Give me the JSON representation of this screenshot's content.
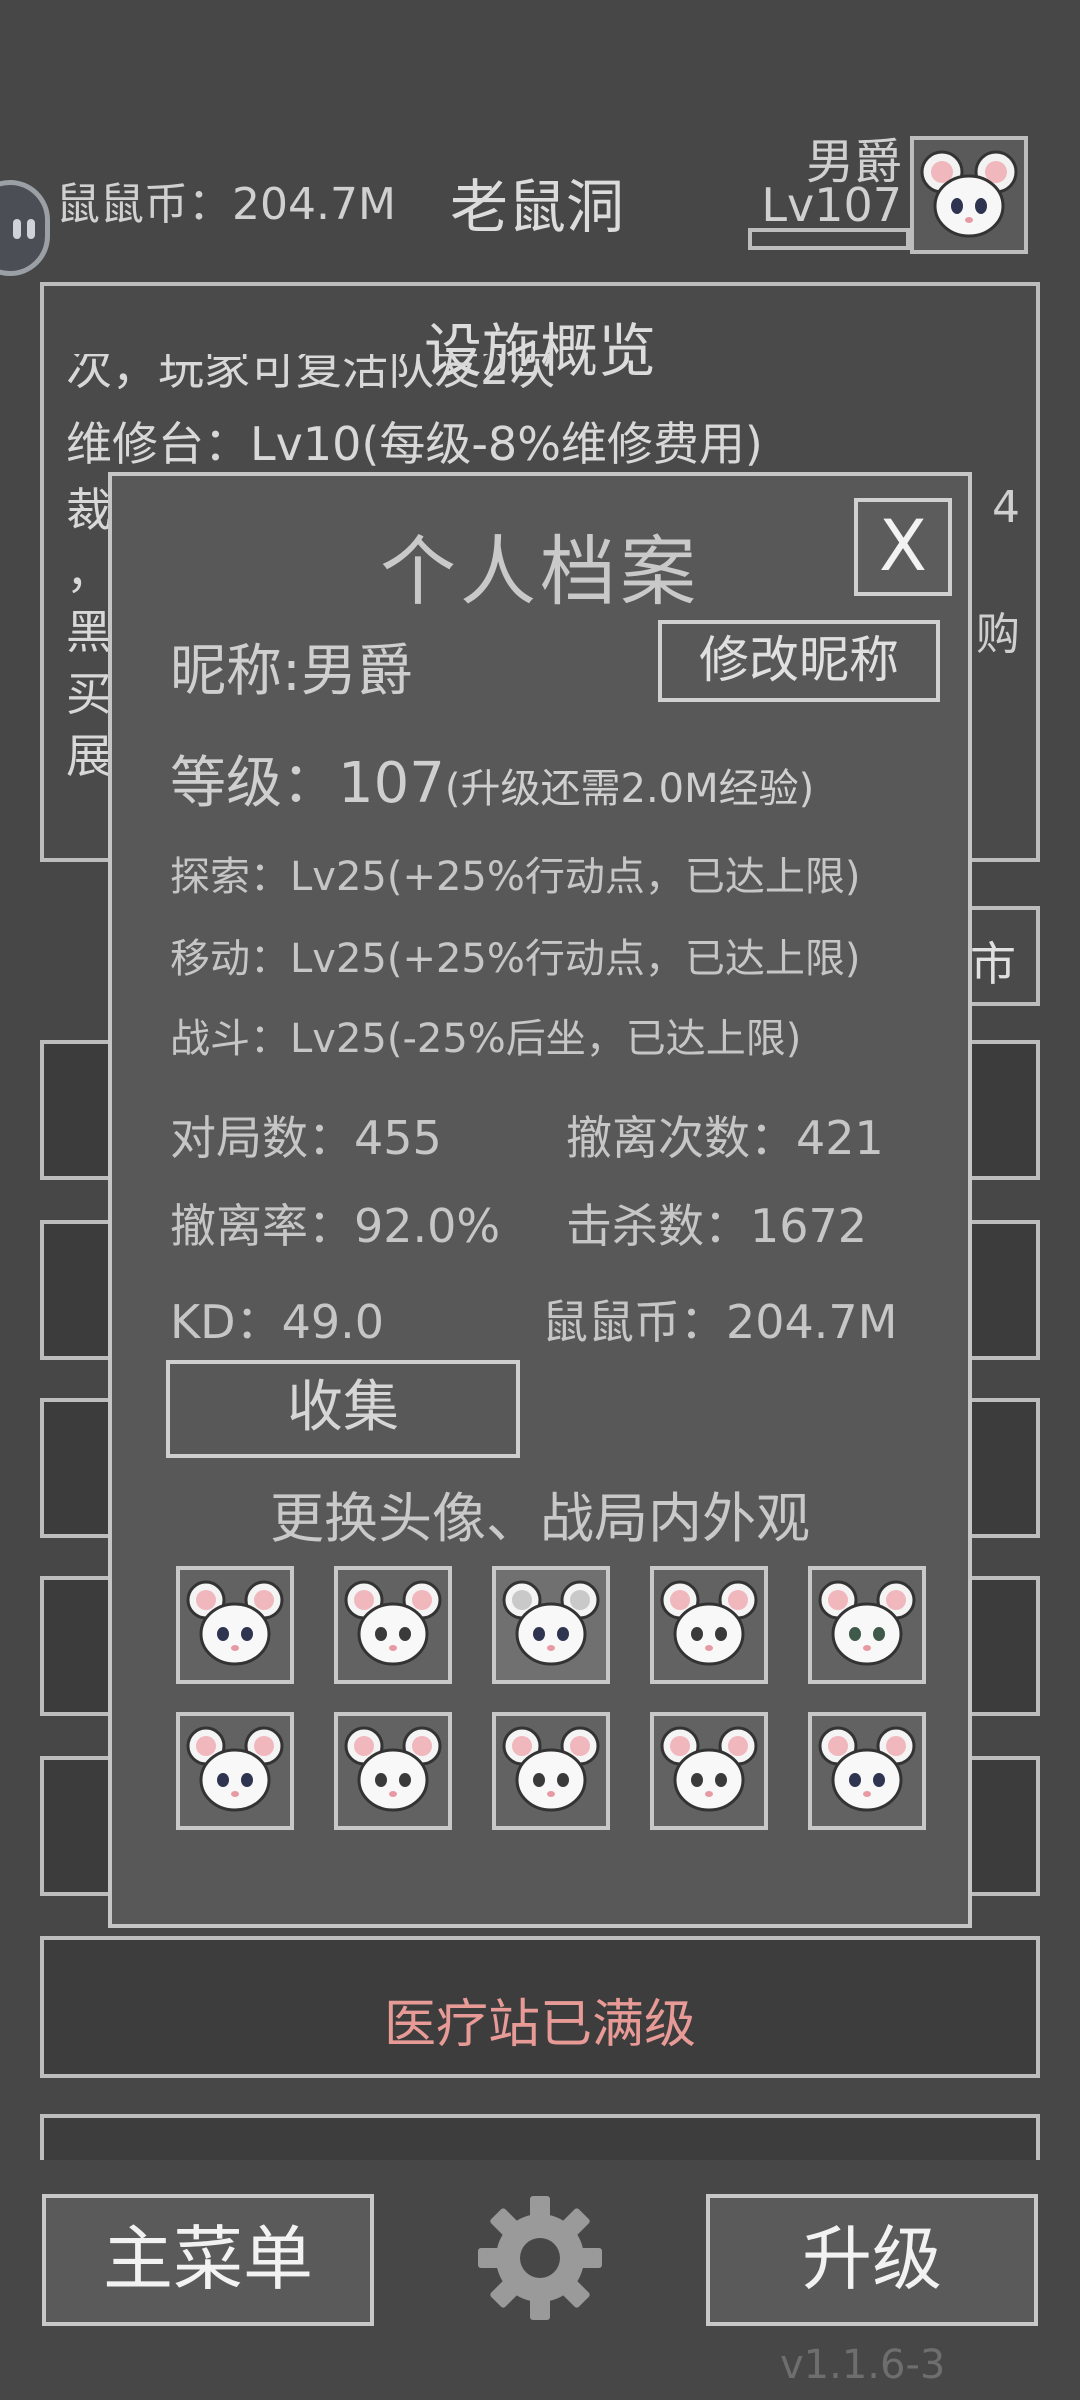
{
  "header": {
    "coins_label": "鼠鼠币：204.7M",
    "location_title": "老鼠洞",
    "user_name": "男爵",
    "user_level": "Lv107",
    "avatar_icon": "white-mouse-avatar-icon"
  },
  "overview": {
    "title": "设施概览",
    "lines": [
      "次，玩家可复活队友2次",
      "维修台：Lv10(每级-8%维修费用)",
      "裁",
      "，",
      "黑",
      "买",
      "展"
    ],
    "right_fragments": [
      "4",
      "购"
    ],
    "market_button_label": "市"
  },
  "medical": {
    "label": "医疗站已满级"
  },
  "footer": {
    "main_menu_label": "主菜单",
    "settings_icon": "gear-icon",
    "upgrade_label": "升级",
    "version": "v1.1.6-3"
  },
  "profile_modal": {
    "title": "个人档案",
    "close_label": "X",
    "nickname_line": "昵称:男爵",
    "rename_label": "修改昵称",
    "level_label": "等级：",
    "level_value": "107",
    "level_note": "(升级还需2.0M经验)",
    "skills": [
      "探索：Lv25(+25%行动点，已达上限)",
      "移动：Lv25(+25%行动点，已达上限)",
      "战斗：Lv25(-25%后坐，已达上限)"
    ],
    "stats": {
      "matches": "对局数：455",
      "extractions": "撤离次数：421",
      "extract_rate": "撤离率：92.0%",
      "kills": "击杀数：1672",
      "kd": "KD：49.0",
      "coins": "鼠鼠币：204.7M"
    },
    "collect_label": "收集",
    "skins_title": "更换头像、战局内外观",
    "skins": [
      "white-mouse-blue-eyes-icon",
      "white-mouse-spiky-icon",
      "white-mouse-grey-ears-icon",
      "white-mouse-grumpy-icon",
      "white-mouse-green-eyes-icon",
      "white-mouse-fluffy-icon",
      "white-mouse-blush-icon",
      "white-mouse-bangs-icon",
      "white-mouse-long-hair-icon",
      "white-mouse-curly-icon"
    ],
    "selected_skin_index": 2
  },
  "colors": {
    "background": "#474747",
    "panel": "#585858",
    "border": "#c6c6c6",
    "accent_text": "#e89a96"
  }
}
